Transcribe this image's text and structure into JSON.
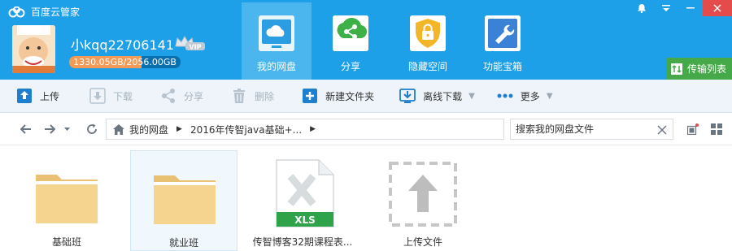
{
  "app": {
    "title": "百度云管家"
  },
  "user": {
    "name": "小kqq22706141",
    "vip_badge": "VIP",
    "quota_text": "1330.05GB/2056.00GB",
    "quota_fraction": 0.647
  },
  "nav": [
    {
      "label": "我的网盘",
      "icon": "cloud-icon",
      "active": true
    },
    {
      "label": "分享",
      "icon": "share-icon",
      "active": false
    },
    {
      "label": "隐藏空间",
      "icon": "lock-icon",
      "active": false
    },
    {
      "label": "功能宝箱",
      "icon": "wrench-icon",
      "active": false
    }
  ],
  "window_controls": [
    "bell-icon",
    "menu-icon",
    "minimize-icon",
    "close-icon"
  ],
  "transfer": {
    "label": "传输列表"
  },
  "toolbar": {
    "upload": "上传",
    "download": "下载",
    "share": "分享",
    "delete": "删除",
    "new_folder": "新建文件夹",
    "offline_download": "离线下载",
    "more": "更多"
  },
  "breadcrumb": {
    "root": "我的网盘",
    "current": "2016年传智java基础+..."
  },
  "search": {
    "placeholder": "搜索我的网盘文件"
  },
  "files": [
    {
      "name": "基础班",
      "type": "folder",
      "selected": false
    },
    {
      "name": "就业班",
      "type": "folder",
      "selected": true
    },
    {
      "name": "传智博客32期课程表...",
      "type": "xls",
      "badge": "XLS"
    },
    {
      "name": "上传文件",
      "type": "upload"
    }
  ],
  "colors": {
    "header": "#1ea0e8",
    "active_nav": "#4bb5ee",
    "transfer": "#46a949",
    "close": "#e44b4b",
    "folder": "#f5d48f"
  }
}
